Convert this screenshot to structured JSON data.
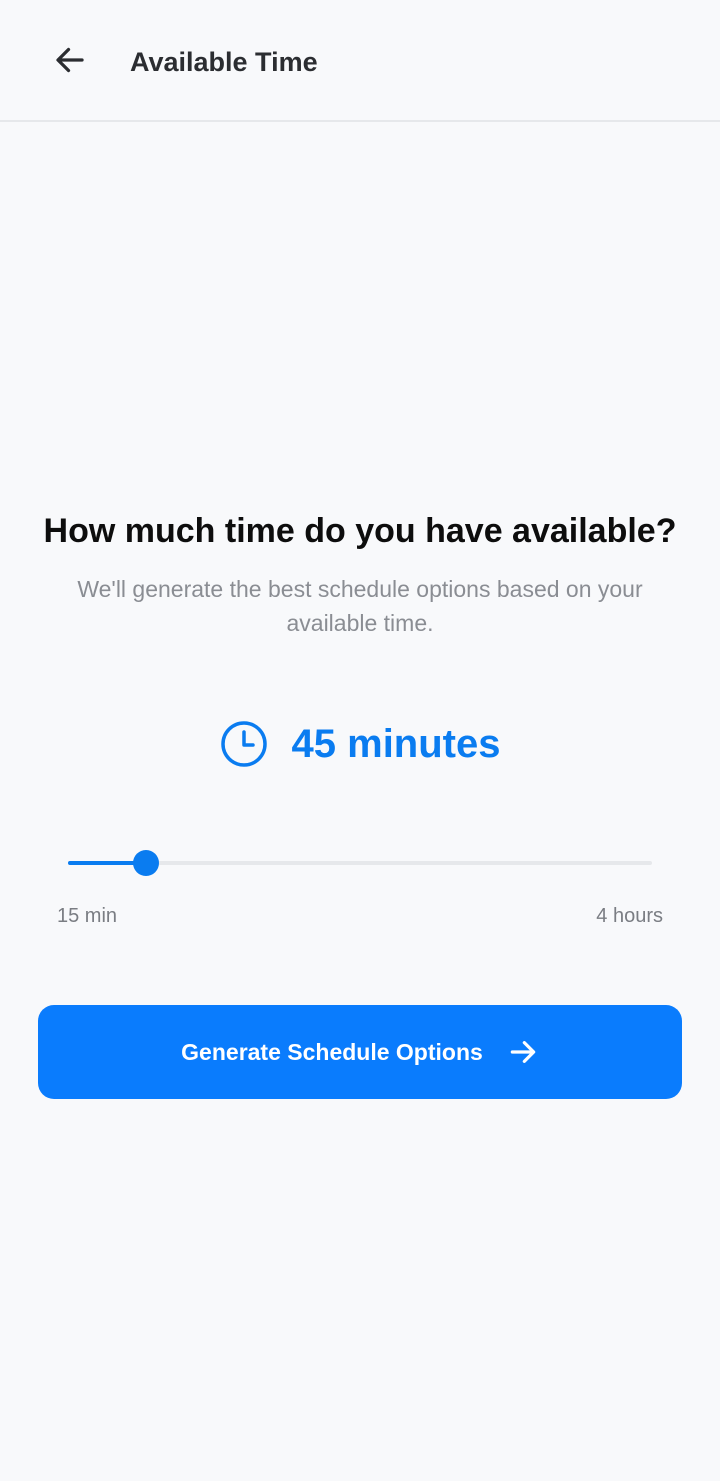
{
  "header": {
    "title": "Available Time",
    "back_icon": "arrow-left-icon"
  },
  "main": {
    "question": "How much time do you have available?",
    "subtitle": "We'll generate the best schedule options based on your available time.",
    "time_icon": "clock-icon",
    "time_value": "45 minutes",
    "slider": {
      "min_label": "15 min",
      "max_label": "4 hours",
      "fraction": 0.133
    },
    "generate_button": {
      "label": "Generate Schedule Options",
      "icon": "arrow-right-icon"
    }
  },
  "colors": {
    "accent": "#0a7cf0",
    "button": "#0a7cfd",
    "background": "#f8f9fb"
  }
}
